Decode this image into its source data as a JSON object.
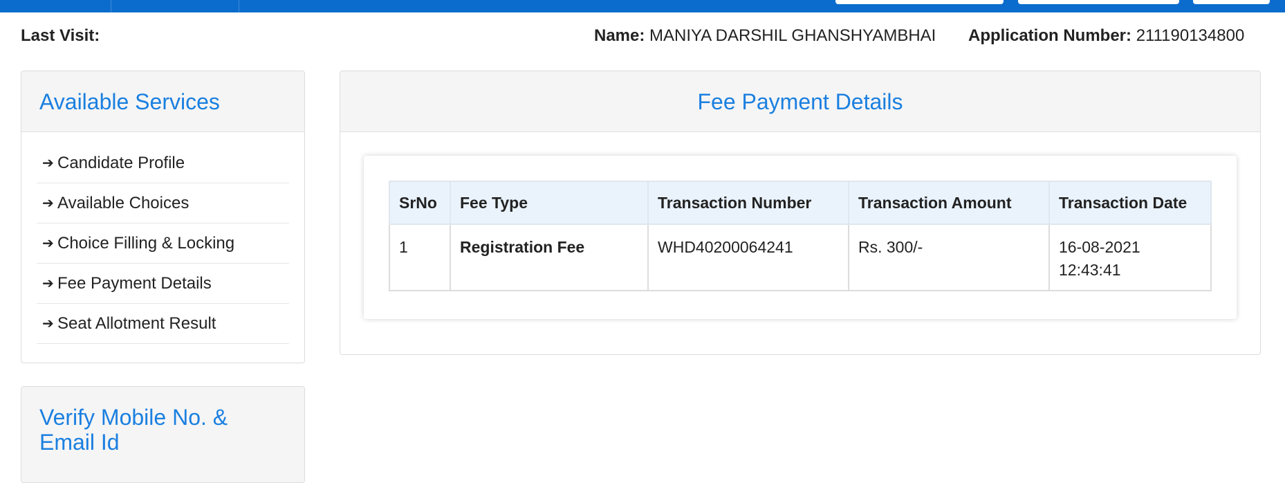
{
  "header": {
    "last_visit_label": "Last Visit:",
    "name_label": "Name:",
    "name_value": "MANIYA DARSHIL GHANSHYAMBHAI",
    "app_number_label": "Application Number:",
    "app_number_value": "211190134800"
  },
  "services_panel": {
    "title": "Available Services",
    "items": [
      {
        "label": "Candidate Profile",
        "icon": "arrow-right-icon"
      },
      {
        "label": "Available Choices",
        "icon": "arrow-right-icon"
      },
      {
        "label": "Choice Filling & Locking",
        "icon": "arrow-right-icon"
      },
      {
        "label": "Fee Payment Details",
        "icon": "arrow-right-icon"
      },
      {
        "label": "Seat Allotment Result",
        "icon": "arrow-right-icon"
      }
    ]
  },
  "verify_panel": {
    "title": "Verify Mobile No. & Email Id"
  },
  "fee_panel": {
    "title": "Fee Payment Details",
    "table": {
      "headers": [
        "SrNo",
        "Fee Type",
        "Transaction Number",
        "Transaction Amount",
        "Transaction Date"
      ],
      "rows": [
        {
          "srno": "1",
          "fee_type": "Registration Fee",
          "transaction_number": "WHD40200064241",
          "transaction_amount": "Rs. 300/-",
          "transaction_date": "16-08-2021",
          "transaction_time": "12:43:41"
        }
      ]
    }
  },
  "colors": {
    "topbar": "#0b6ccd",
    "heading_blue": "#1a7fe0",
    "table_header_bg": "#eaf3fc"
  }
}
